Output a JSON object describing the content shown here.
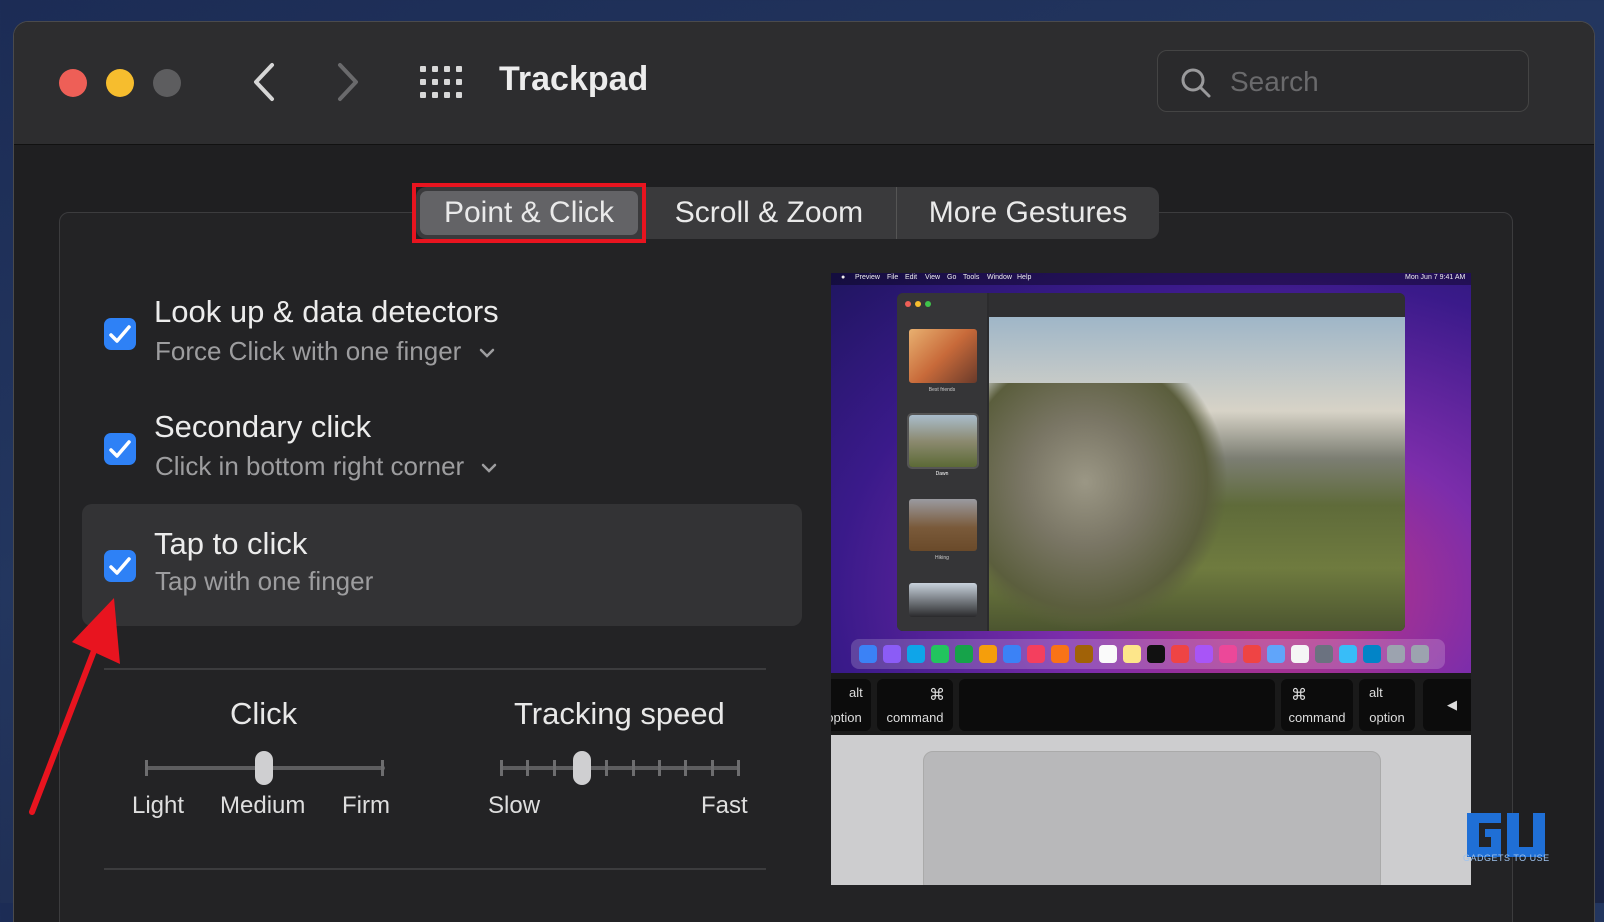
{
  "window": {
    "title": "Trackpad",
    "traffic_lights": [
      "red",
      "yellow",
      "gray"
    ]
  },
  "toolbar": {
    "back_icon": "chevron-left-icon",
    "forward_icon": "chevron-right-icon",
    "grid_icon": "show-all-grid-icon"
  },
  "search": {
    "placeholder": "Search",
    "value": ""
  },
  "tabs": [
    {
      "label": "Point & Click",
      "selected": true
    },
    {
      "label": "Scroll & Zoom",
      "selected": false
    },
    {
      "label": "More Gestures",
      "selected": false
    }
  ],
  "options": [
    {
      "title": "Look up & data detectors",
      "subtitle": "Force Click with one finger",
      "checked": true,
      "has_dropdown": true
    },
    {
      "title": "Secondary click",
      "subtitle": "Click in bottom right corner",
      "checked": true,
      "has_dropdown": true
    },
    {
      "title": "Tap to click",
      "subtitle": "Tap with one finger",
      "checked": true,
      "has_dropdown": false
    }
  ],
  "click_slider": {
    "title": "Click",
    "labels": [
      "Light",
      "Medium",
      "Firm"
    ],
    "selected": "Medium"
  },
  "tracking_slider": {
    "title": "Tracking speed",
    "min_label": "Slow",
    "max_label": "Fast",
    "value_fraction": 0.34
  },
  "preview": {
    "menubar_items": [
      "Preview",
      "File",
      "Edit",
      "View",
      "Go",
      "Tools",
      "Window",
      "Help"
    ],
    "menubar_clock": "Mon Jun 7 9:41 AM",
    "sidebar_captions": [
      "Best friends",
      "Dawn",
      "Hiking"
    ],
    "keys": [
      {
        "symbol": "alt",
        "name": "option"
      },
      {
        "symbol": "⌘",
        "name": "command"
      },
      {
        "symbol": "⌘",
        "name": "command"
      },
      {
        "symbol": "alt",
        "name": "option"
      }
    ]
  },
  "watermark": {
    "text": "GADGETS TO USE"
  },
  "colors": {
    "accent": "#2e81f6",
    "highlight": "#e8141f",
    "window_bg": "#1f1f21"
  }
}
